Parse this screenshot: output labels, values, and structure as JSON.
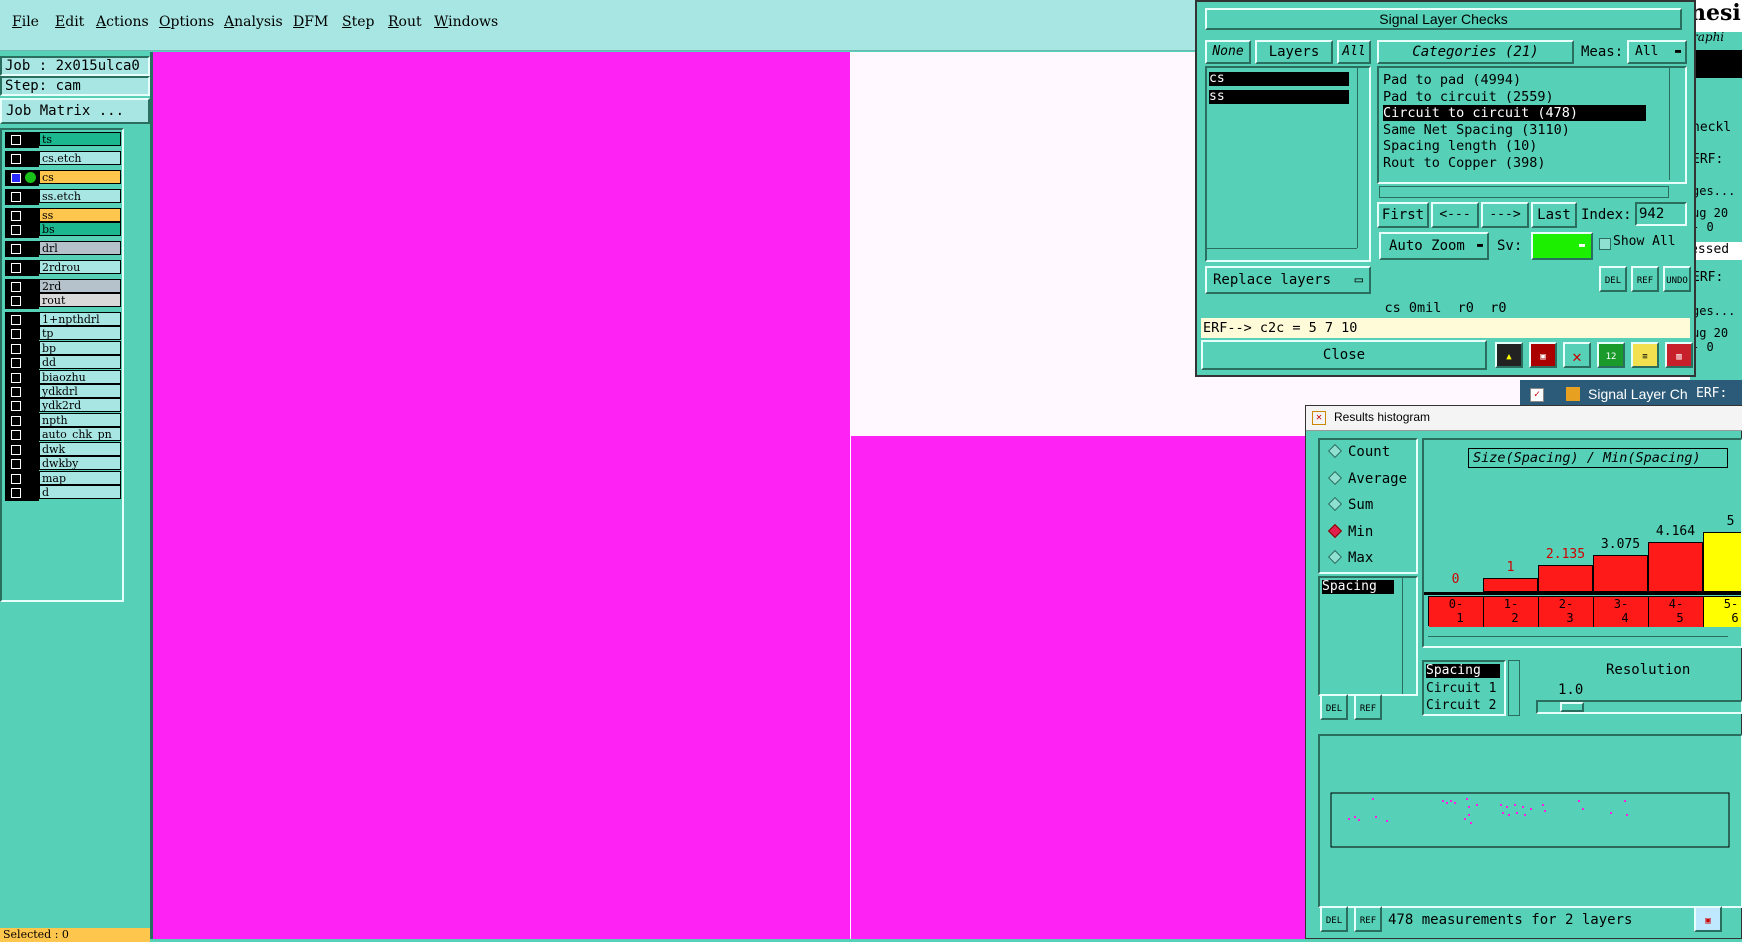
{
  "menu": [
    "File",
    "Edit",
    "Actions",
    "Options",
    "Analysis",
    "DFM",
    "Step",
    "Rout",
    "Windows"
  ],
  "job": {
    "label": "Job : 2x015ulca0",
    "step": "Step: cam",
    "matrix_button": "Job Matrix ..."
  },
  "layers": [
    {
      "name": "ts",
      "color": "#1bb78e"
    },
    {
      "name": "cs.etch",
      "color": "#a7e6e2"
    },
    {
      "name": "cs",
      "color": "#ffc64d"
    },
    {
      "name": "ss.etch",
      "color": "#a7e6e2"
    },
    {
      "name": "ss",
      "color": "#ffc64d"
    },
    {
      "name": "bs",
      "color": "#1bb78e"
    },
    {
      "name": "drl",
      "color": "#b6c2cb"
    },
    {
      "name": "2rdrou",
      "color": "#a7e6e2"
    },
    {
      "name": "2rd",
      "color": "#b6c2cb"
    },
    {
      "name": "rout",
      "color": "#d9d9d9"
    },
    {
      "name": "1+npthdrl",
      "color": "#a7e6e2"
    },
    {
      "name": "tp",
      "color": "#a7e6e2"
    },
    {
      "name": "bp",
      "color": "#a7e6e2"
    },
    {
      "name": "dd",
      "color": "#a7e6e2"
    },
    {
      "name": "biaozhu",
      "color": "#a7e6e2"
    },
    {
      "name": "ydkdrl",
      "color": "#a7e6e2"
    },
    {
      "name": "ydk2rd",
      "color": "#a7e6e2"
    },
    {
      "name": "npth",
      "color": "#a7e6e2"
    },
    {
      "name": "auto_chk_pn",
      "color": "#a7e6e2"
    },
    {
      "name": "dwk",
      "color": "#a7e6e2"
    },
    {
      "name": "dwkby",
      "color": "#a7e6e2"
    },
    {
      "name": "map",
      "color": "#a7e6e2"
    },
    {
      "name": "d",
      "color": "#a7e6e2"
    }
  ],
  "selected_status": "Selected : 0",
  "signal_window": {
    "title": "Signal Layer Checks",
    "none_btn": "None",
    "layers_label": "Layers",
    "all_btn": "All",
    "layer_list": [
      "cs",
      "ss"
    ],
    "categories_label": "Categories (21)",
    "meas_label": "Meas:",
    "meas_value": "All",
    "categories": [
      "Pad to pad (4994)",
      "Pad to circuit (2559)",
      "Circuit to circuit (478)",
      "Same Net Spacing (3110)",
      "Spacing length (10)",
      "Rout to Copper (398)"
    ],
    "selected_category_index": 2,
    "first_btn": "First",
    "prev_btn": "<---",
    "next_btn": "--->",
    "last_btn": "Last",
    "index_label": "Index:",
    "index_value": "942",
    "auto_zoom": "Auto Zoom",
    "sv_label": "Sv:",
    "show_all": "Show All",
    "replace_layers": "Replace layers",
    "status_line": "cs 0mil  r0  r0",
    "erf_line": "ERF--> c2c = 5 7 10",
    "close_btn": "Close",
    "del_btn": "DEL",
    "ref_btn": "REF",
    "undo_btn": "UNDO",
    "icons": [
      "inspect-icon",
      "highlight-icon",
      "erf-cross-icon",
      "counter-icon",
      "report-icon",
      "histogram-icon"
    ]
  },
  "background_window": {
    "title_fragment": "nesi",
    "subtitle_fragment": "raphi",
    "checklist_fragment": "heckl",
    "erf": "ERF:",
    "ges": "ges...",
    "aug": "ug 20",
    "dash": "- 0",
    "essed": "essed",
    "taskbar_item": "Signal Layer Ch",
    "taskbar_erf": "ERF:"
  },
  "histogram_window": {
    "title": "Results histogram",
    "modes": [
      "Count",
      "Average",
      "Sum",
      "Min",
      "Max"
    ],
    "selected_mode": "Min",
    "list_item": "Spacing",
    "header_label": "Size(Spacing) / Min(Spacing)",
    "table_items": [
      "Spacing",
      "Circuit 1",
      "Circuit 2"
    ],
    "resolution_label": "Resolution",
    "resolution_value": "1.0",
    "status": "478 measurements for 2 layers",
    "del_btn": "DEL",
    "ref_btn": "REF"
  },
  "chart_data": {
    "type": "bar",
    "title": "Size(Spacing) / Min(Spacing)",
    "categories": [
      "0-1",
      "1-2",
      "2-3",
      "3-4",
      "4-5",
      "5-6"
    ],
    "values": [
      0,
      1,
      2.135,
      3.075,
      4.164,
      5
    ],
    "value_labels": [
      "0",
      "1",
      "2.135",
      "3.075",
      "4.164",
      "5"
    ],
    "bar_colors": [
      "#ff1a1a",
      "#ff1a1a",
      "#ff1a1a",
      "#ff1a1a",
      "#ff1a1a",
      "#ffff00"
    ],
    "label_colors": [
      "#d00000",
      "#d00000",
      "#d00000",
      "#000000",
      "#000000",
      "#000000"
    ],
    "bin_labels": [
      [
        "0-",
        "1"
      ],
      [
        "1-",
        "2"
      ],
      [
        "2-",
        "3"
      ],
      [
        "3-",
        "4"
      ],
      [
        "4-",
        "5"
      ],
      [
        "5-",
        "6"
      ]
    ]
  },
  "colors": {
    "panel": "#56d0b6",
    "highlight": "#a7e6e2",
    "canvas": "#ff22f5",
    "selected_layer": "#ffc64d"
  }
}
